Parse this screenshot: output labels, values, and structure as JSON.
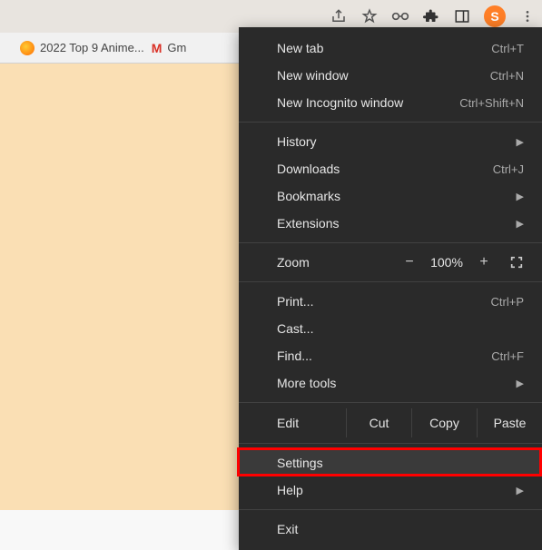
{
  "toolbar": {
    "avatar_letter": "S"
  },
  "bookmarks": {
    "items": [
      {
        "label": "2022 Top 9 Anime..."
      },
      {
        "label": "Gm"
      }
    ]
  },
  "menu": {
    "new_tab": {
      "label": "New tab",
      "shortcut": "Ctrl+T"
    },
    "new_window": {
      "label": "New window",
      "shortcut": "Ctrl+N"
    },
    "new_incognito": {
      "label": "New Incognito window",
      "shortcut": "Ctrl+Shift+N"
    },
    "history": {
      "label": "History"
    },
    "downloads": {
      "label": "Downloads",
      "shortcut": "Ctrl+J"
    },
    "bookmarks": {
      "label": "Bookmarks"
    },
    "extensions": {
      "label": "Extensions"
    },
    "zoom": {
      "label": "Zoom",
      "value": "100%",
      "minus": "−",
      "plus": "+"
    },
    "print": {
      "label": "Print...",
      "shortcut": "Ctrl+P"
    },
    "cast": {
      "label": "Cast..."
    },
    "find": {
      "label": "Find...",
      "shortcut": "Ctrl+F"
    },
    "more_tools": {
      "label": "More tools"
    },
    "edit": {
      "label": "Edit",
      "cut": "Cut",
      "copy": "Copy",
      "paste": "Paste"
    },
    "settings": {
      "label": "Settings"
    },
    "help": {
      "label": "Help"
    },
    "exit": {
      "label": "Exit"
    }
  }
}
